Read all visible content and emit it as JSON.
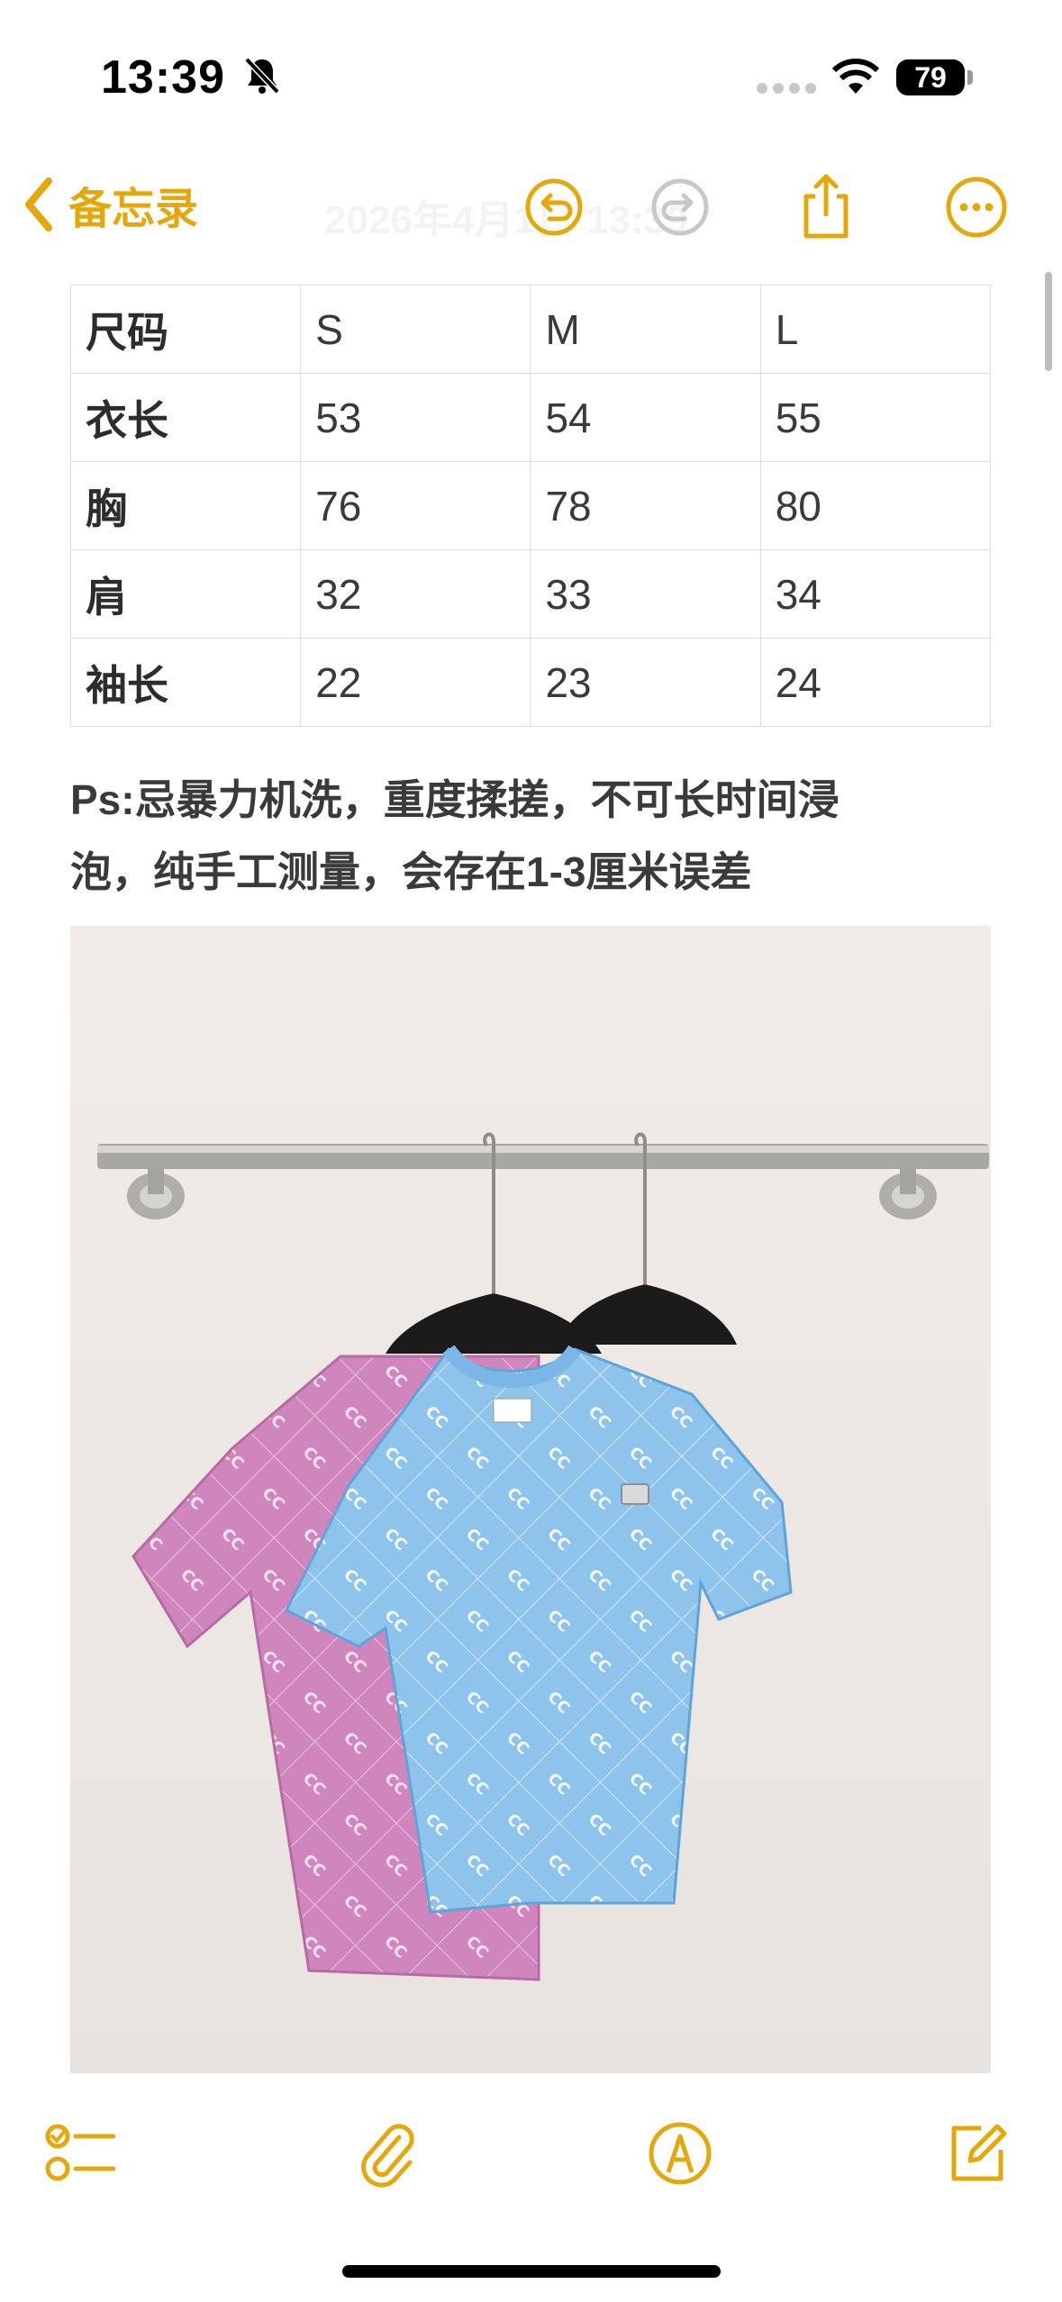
{
  "status_bar": {
    "time": "13:39",
    "battery": "79"
  },
  "nav": {
    "back_label": "备忘录",
    "title": "2026年4月1日 13:39"
  },
  "table": {
    "header": [
      "尺码",
      "S",
      "M",
      "L"
    ],
    "rows": [
      [
        "衣长",
        "53",
        "54",
        "55"
      ],
      [
        "胸",
        "76",
        "78",
        "80"
      ],
      [
        "肩",
        "32",
        "33",
        "34"
      ],
      [
        "袖长",
        "22",
        "23",
        "24"
      ]
    ]
  },
  "note": {
    "line1": "Ps:忌暴力机洗，重度揉搓，不可长时间浸",
    "line2": "泡，纯手工测量，会存在1-3厘米误差"
  },
  "colors": {
    "accent": "#e5a80c",
    "pink_shirt": "#cf86bd",
    "blue_shirt": "#8ec3ec",
    "wall": "#efe9e5"
  },
  "icons": [
    "bell-slash-icon",
    "wifi-icon",
    "chevron-left-icon",
    "undo-icon",
    "redo-icon",
    "share-icon",
    "more-icon",
    "checklist-icon",
    "paperclip-icon",
    "markup-pen-icon",
    "compose-icon"
  ]
}
